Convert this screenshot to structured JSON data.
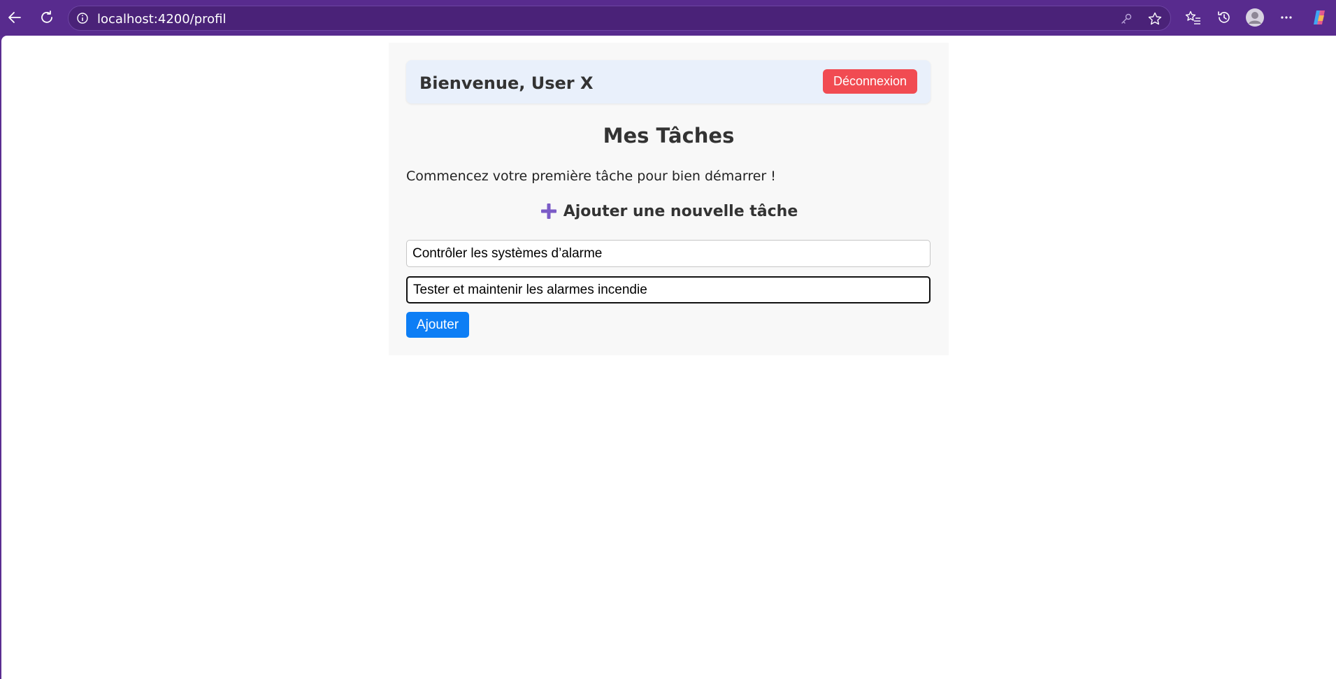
{
  "browser": {
    "url": "localhost:4200/profil",
    "colors": {
      "frame": "#582b8e",
      "address_bg": "#4a2278"
    }
  },
  "header": {
    "welcome": "Bienvenue, User X",
    "logout_label": "Déconnexion"
  },
  "main": {
    "title": "Mes Tâches",
    "intro": "Commencez votre première tâche pour bien démarrer !",
    "add_heading": "Ajouter une nouvelle tâche",
    "add_icon": "plus-icon",
    "fields": {
      "title_value": "Contrôler les systèmes d’alarme",
      "description_value": "Tester et maintenir les alarmes incendie"
    },
    "add_button_label": "Ajouter"
  },
  "colors": {
    "logout": "#f14b52",
    "primary": "#0d7ef5",
    "plus_icon": "#7b5cc7",
    "welcome_card": "#e9f0fb"
  }
}
